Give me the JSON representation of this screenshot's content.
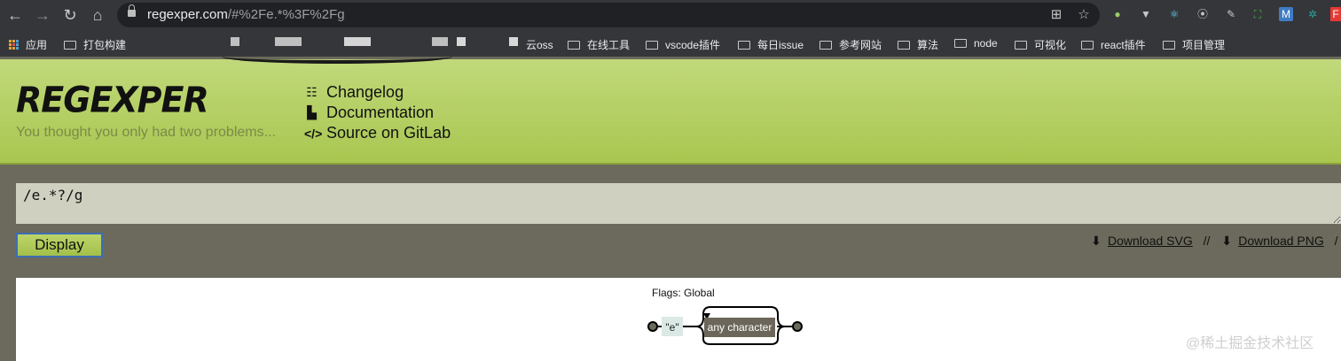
{
  "browser": {
    "url_host": "regexper.com",
    "url_rest": "/#%2Fe.*%3F%2Fg",
    "icons": [
      "back-icon",
      "forward-icon",
      "reload-icon",
      "home-icon",
      "translate-icon",
      "star-icon"
    ],
    "bookmarks": [
      {
        "label": "应用",
        "type": "apps"
      },
      {
        "label": "打包构建",
        "type": "folder"
      },
      {
        "label": "云oss",
        "type": "folder"
      },
      {
        "label": "在线工具",
        "type": "folder"
      },
      {
        "label": "vscode插件",
        "type": "folder"
      },
      {
        "label": "每日issue",
        "type": "folder"
      },
      {
        "label": "参考网站",
        "type": "folder"
      },
      {
        "label": "算法",
        "type": "folder"
      },
      {
        "label": "node",
        "type": "folder"
      },
      {
        "label": "可视化",
        "type": "folder"
      },
      {
        "label": "react插件",
        "type": "folder"
      },
      {
        "label": "项目管理",
        "type": "folder"
      }
    ]
  },
  "site": {
    "logo": "REGEXPER",
    "tagline": "You thought you only had two problems...",
    "nav": [
      {
        "label": "Changelog",
        "icon": "list-icon"
      },
      {
        "label": "Documentation",
        "icon": "document-icon"
      },
      {
        "label": "Source on GitLab",
        "icon": "code-icon"
      }
    ]
  },
  "editor": {
    "regex": "/e.*?/g",
    "display_label": "Display",
    "download_svg": "Download SVG",
    "download_png": "Download PNG",
    "separator": "//",
    "trailing": "/"
  },
  "diagram": {
    "flags": "Flags: Global",
    "literal": "\"e\"",
    "any_char": "any character"
  },
  "watermark": "@稀土掘金技术社区"
}
